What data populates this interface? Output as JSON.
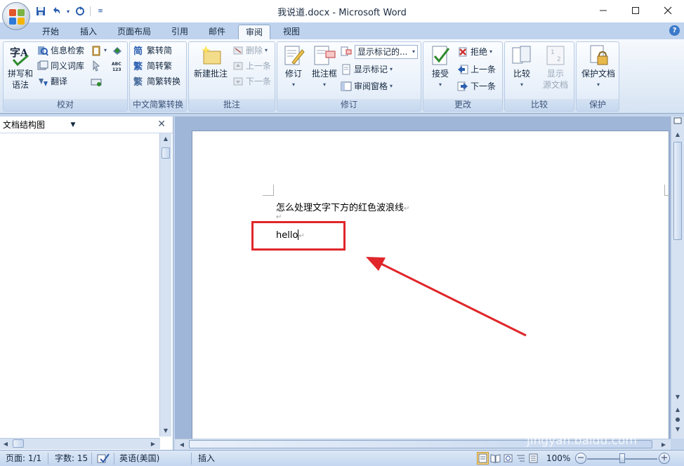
{
  "window": {
    "title": "我说道.docx - Microsoft Word",
    "minimize_icon": "minimize-icon",
    "maximize_icon": "maximize-icon",
    "close_icon": "close-icon"
  },
  "quick_access": [
    "save-icon",
    "undo-icon",
    "redo-icon",
    "customize-icon"
  ],
  "tabs": [
    {
      "label": "开始"
    },
    {
      "label": "插入"
    },
    {
      "label": "页面布局"
    },
    {
      "label": "引用"
    },
    {
      "label": "邮件"
    },
    {
      "label": "审阅",
      "active": true
    },
    {
      "label": "视图"
    }
  ],
  "ribbon": {
    "proofing": {
      "label": "校对",
      "spelling": "拼写和\n语法",
      "research": "信息检索",
      "thesaurus": "同义词库",
      "translate": "翻译"
    },
    "chinese_conversion": {
      "label": "中文简繁转换",
      "to_simplified": "繁转简",
      "to_traditional": "简转繁",
      "conversion": "简繁转换"
    },
    "comments": {
      "label": "批注",
      "new_comment": "新建批注",
      "delete": "删除",
      "previous": "上一条",
      "next": "下一条"
    },
    "tracking": {
      "label": "修订",
      "track_changes": "修订",
      "balloons": "批注框",
      "display_combo": "显示标记的...",
      "show_markup": "显示标记",
      "reviewing_pane": "审阅窗格"
    },
    "changes": {
      "label": "更改",
      "accept": "接受",
      "reject": "拒绝",
      "previous": "上一条",
      "next": "下一条"
    },
    "compare": {
      "label": "比较",
      "compare": "比较",
      "show_source": "显示\n源文档"
    },
    "protect": {
      "label": "保护",
      "protect_document": "保护文档"
    }
  },
  "document_map": {
    "title": "文档结构图"
  },
  "document": {
    "line1": "怎么处理文字下方的红色波浪线",
    "line2": "hello",
    "paragraph_mark": "↵"
  },
  "status_bar": {
    "page": "页面: 1/1",
    "words": "字数: 15",
    "language": "英语(美国)",
    "mode": "插入",
    "zoom": "100%",
    "zoom_level": 1.0
  },
  "watermark": {
    "brand": "Bai du 经验",
    "url": "jingyan.baidu.com"
  },
  "colors": {
    "accent": "#3b79c9",
    "annotation_red": "#e0262a",
    "ribbon_bg": "#dfe9f5"
  }
}
